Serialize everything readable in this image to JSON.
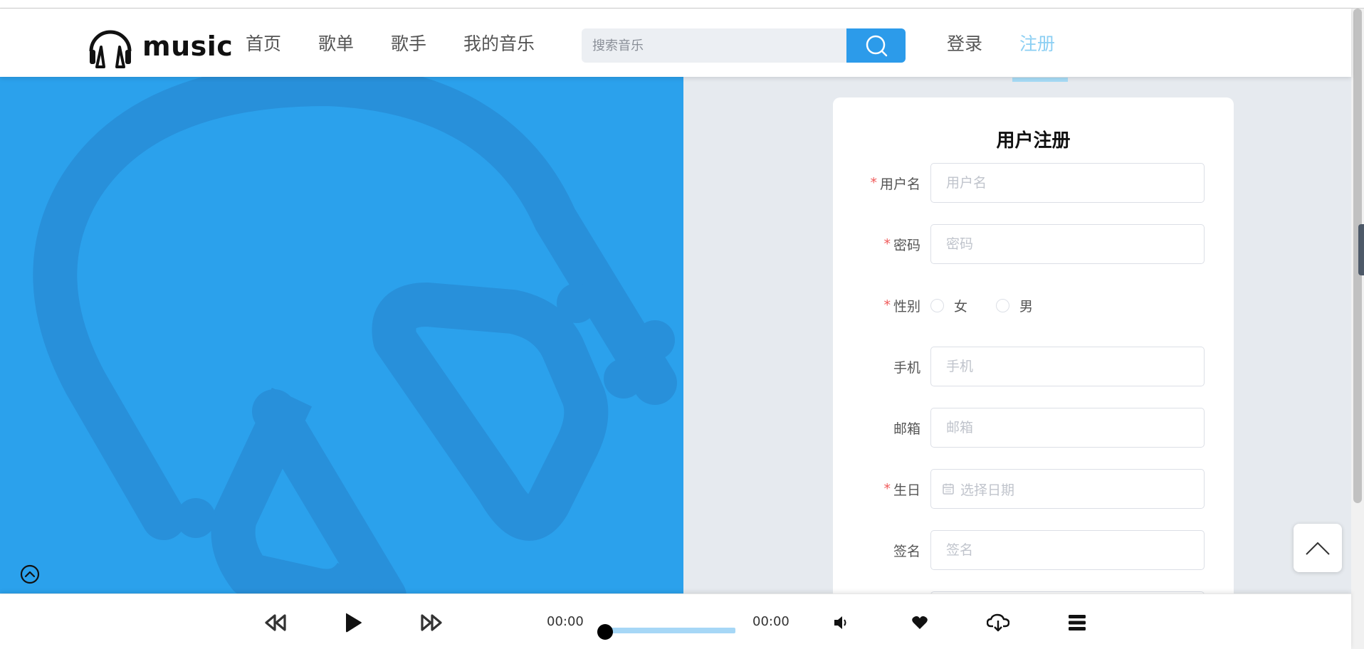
{
  "header": {
    "logo_text": "music",
    "nav": [
      "首页",
      "歌单",
      "歌手",
      "我的音乐"
    ],
    "search_placeholder": "搜索音乐",
    "login_label": "登录",
    "register_label": "注册",
    "register_color": "#8ccff3",
    "search_button_color": "#2c9bea"
  },
  "hero": {
    "background_color": "#2ba1ec"
  },
  "form": {
    "title": "用户注册",
    "username": {
      "label": "用户名",
      "required_mark": "*",
      "placeholder": "用户名"
    },
    "password": {
      "label": "密码",
      "required_mark": "*",
      "placeholder": "密码"
    },
    "gender": {
      "label": "性别",
      "required_mark": "*",
      "options": [
        "女",
        "男"
      ]
    },
    "phone": {
      "label": "手机",
      "placeholder": "手机"
    },
    "email": {
      "label": "邮箱",
      "placeholder": "邮箱"
    },
    "birthday": {
      "label": "生日",
      "required_mark": "*",
      "placeholder": "选择日期",
      "icon": "calendar-icon"
    },
    "signature": {
      "label": "签名",
      "placeholder": "签名"
    }
  },
  "player": {
    "current_time": "00:00",
    "total_time": "00:00",
    "progress": 0,
    "icons": [
      "rewind-icon",
      "play-icon",
      "fast-forward-icon",
      "volume-icon",
      "heart-icon",
      "cloud-download-icon",
      "playlist-icon"
    ]
  }
}
